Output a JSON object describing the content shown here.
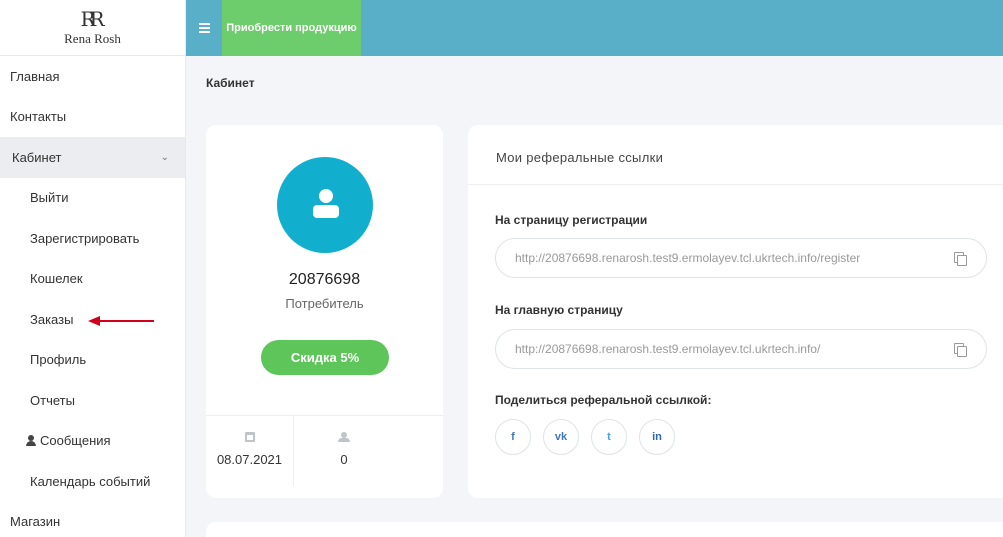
{
  "logo": {
    "mark": "RR",
    "text": "Rena Rosh"
  },
  "sidebar": {
    "items": [
      {
        "label": "Главная"
      },
      {
        "label": "Контакты"
      },
      {
        "label": "Кабинет"
      },
      {
        "label": "Выйти"
      },
      {
        "label": "Зарегистрировать"
      },
      {
        "label": "Кошелек"
      },
      {
        "label": "Заказы"
      },
      {
        "label": "Профиль"
      },
      {
        "label": "Отчеты"
      },
      {
        "label": "Сообщения"
      },
      {
        "label": "Календарь событий"
      },
      {
        "label": "Магазин"
      }
    ]
  },
  "topbar": {
    "buy_label": "Приобрести продукцию"
  },
  "breadcrumb": "Кабинет",
  "profile": {
    "id": "20876698",
    "role": "Потребитель",
    "discount": "Скидка 5%",
    "date": "08.07.2021",
    "referrals": "0"
  },
  "referral": {
    "title": "Мои реферальные ссылки",
    "register_label": "На страницу регистрации",
    "register_url": "http://20876698.renarosh.test9.ermolayev.tcl.ukrtech.info/register",
    "home_label": "На главную страницу",
    "home_url": "http://20876698.renarosh.test9.ermolayev.tcl.ukrtech.info/",
    "share_label": "Поделиться реферальной ссылкой:",
    "socials": [
      "f",
      "vk",
      "t",
      "in"
    ]
  },
  "colors": {
    "topbar": "#5aafc8",
    "buy_button": "#6dcc6b",
    "avatar": "#12aecd",
    "discount": "#5ec55b",
    "arrow": "#d0021b"
  }
}
